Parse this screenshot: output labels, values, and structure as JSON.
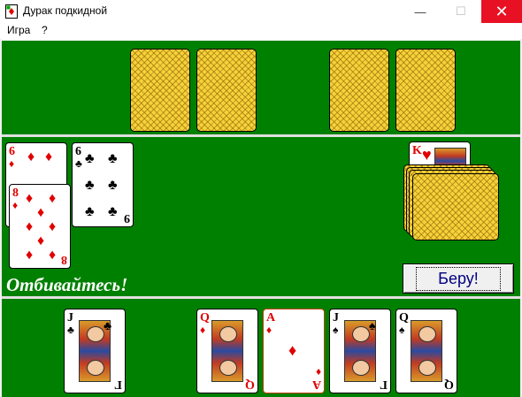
{
  "window": {
    "title": "Дурак подкидной",
    "min": "—",
    "max": "☐",
    "close": "✕"
  },
  "menu": {
    "items": [
      "Игра",
      "?"
    ]
  },
  "status": {
    "message": "Отбивайтесь!"
  },
  "take_button": {
    "label": "Беру!"
  },
  "trump_card": {
    "rank": "K",
    "suit": "♥"
  },
  "table_cards": [
    {
      "rank": "6",
      "suit": "♦",
      "color": "red"
    },
    {
      "rank": "8",
      "suit": "♦",
      "color": "red"
    },
    {
      "rank": "6",
      "suit": "♣",
      "color": "black",
      "corner_br": "9"
    }
  ],
  "player_hand": [
    {
      "rank": "J",
      "suit": "♣",
      "color": "black",
      "corner_br": "Г"
    },
    {
      "rank": "Q",
      "suit": "♦",
      "color": "red",
      "corner_br": "Q"
    },
    {
      "rank": "A",
      "suit": "♦",
      "color": "red",
      "corner_br": "A"
    },
    {
      "rank": "J",
      "suit": "♠",
      "color": "black",
      "corner_br": "Г"
    },
    {
      "rank": "Q",
      "suit": "♠",
      "color": "black",
      "corner_br": "Q"
    }
  ]
}
